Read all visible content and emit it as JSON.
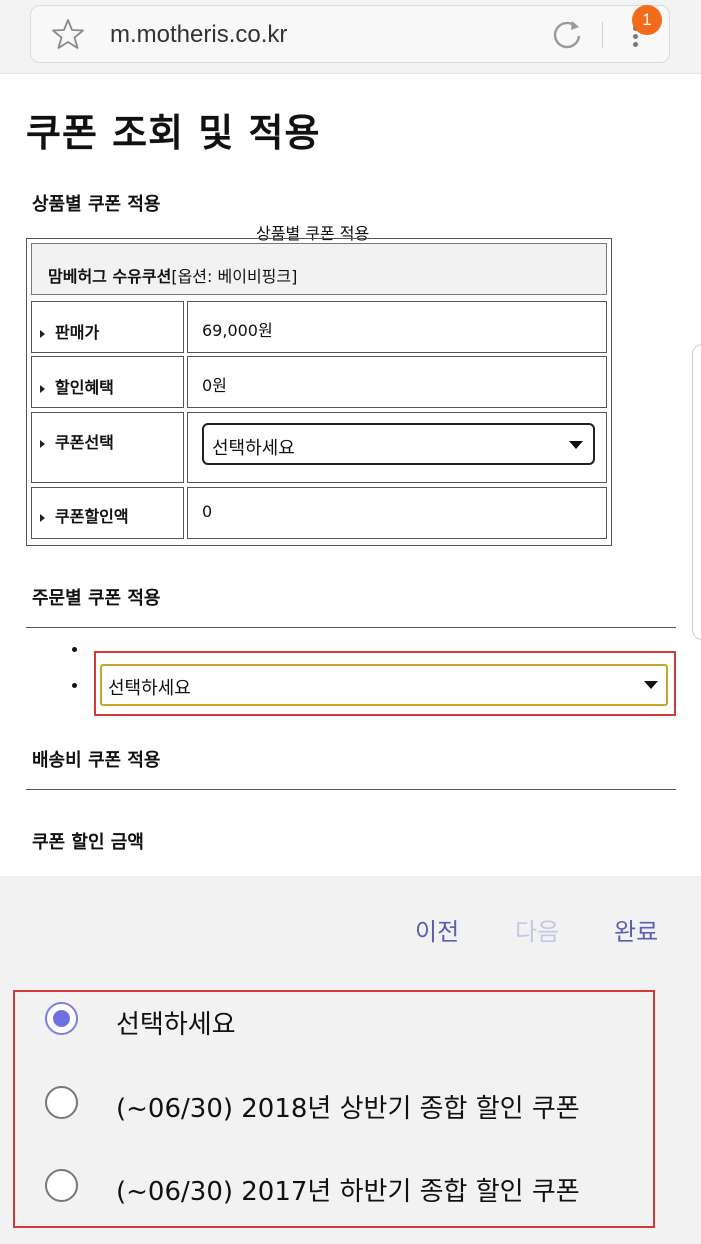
{
  "browser": {
    "url": "m.motheris.co.kr",
    "notification_count": "1"
  },
  "page": {
    "title": "쿠폰 조회 및 적용",
    "product_section_title": "상품별 쿠폰 적용",
    "table_caption": "상품별 쿠폰 적용",
    "product_name": "맘베허그 수유쿠션",
    "product_option": "[옵션: 베이비핑크]",
    "rows": [
      {
        "label": "판매가",
        "value": "69,000원"
      },
      {
        "label": "할인혜택",
        "value": "0원"
      },
      {
        "label": "쿠폰선택",
        "value": "선택하세요"
      },
      {
        "label": "쿠폰할인액",
        "value": "0"
      }
    ],
    "order_section_title": "주문별 쿠폰 적용",
    "order_select_value": "선택하세요",
    "shipping_section_title": "배송비 쿠폰 적용",
    "discount_total_title": "쿠폰 할인 금액"
  },
  "picker": {
    "prev_label": "이전",
    "next_label": "다음",
    "done_label": "완료",
    "options": [
      {
        "label": "선택하세요",
        "checked": true
      },
      {
        "label": "(~06/30) 2018년 상반기 종합 할인 쿠폰",
        "checked": false
      },
      {
        "label": "(~06/30) 2017년 하반기 종합 할인 쿠폰",
        "checked": false
      }
    ]
  },
  "colors": {
    "accent": "#5a5fb5",
    "highlight_border": "#d13a3a",
    "badge": "#f26a1b"
  }
}
